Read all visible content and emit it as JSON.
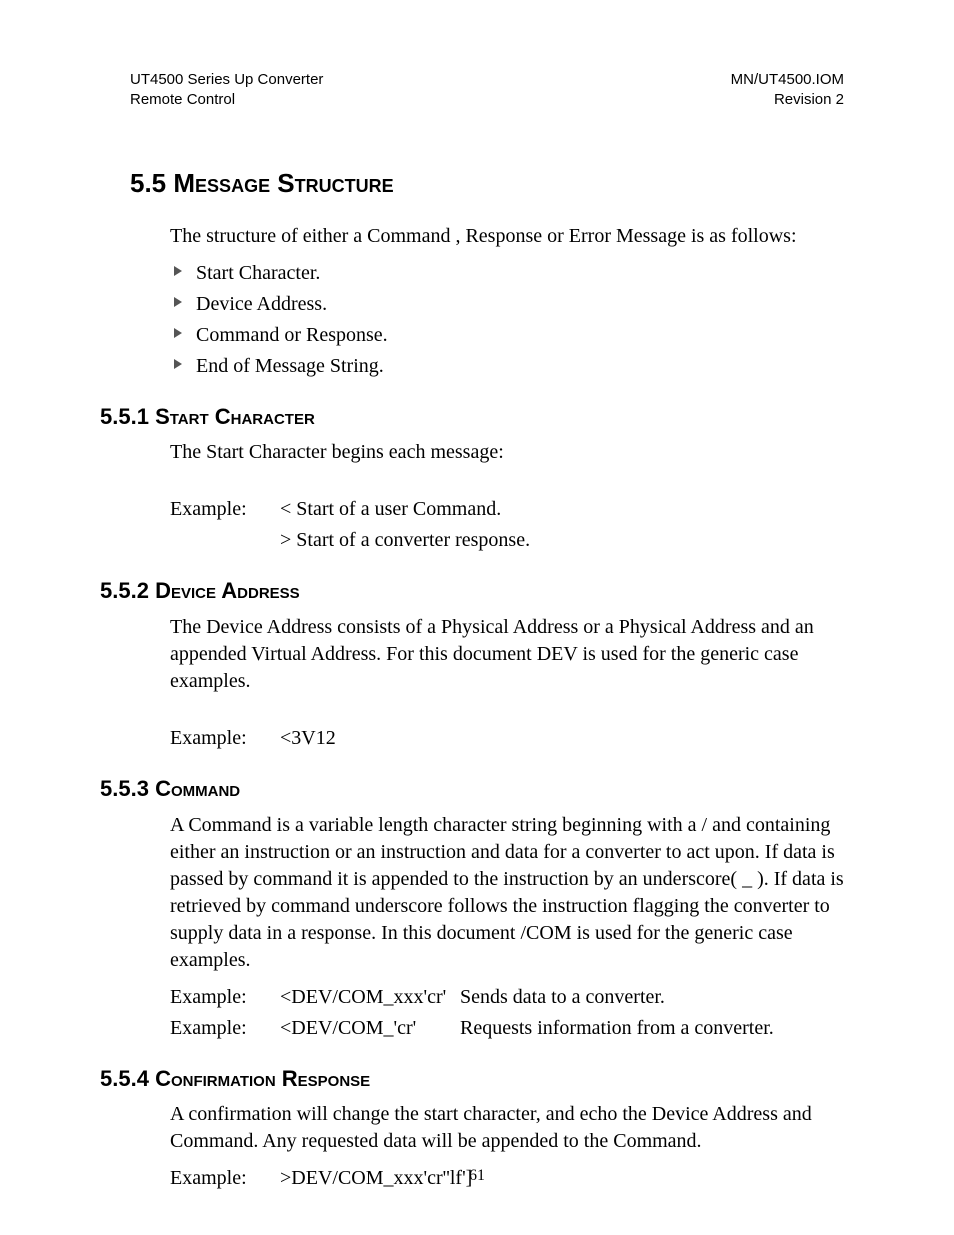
{
  "header": {
    "top_left_1": "UT4500 Series Up Converter",
    "top_left_2": "Remote Control",
    "top_right_1": "MN/UT4500.IOM",
    "top_right_2": "Revision 2"
  },
  "section_main": {
    "number": "5.5",
    "title": "Message Structure",
    "intro": "The structure of either a Command , Response or Error Message is as follows:",
    "bullets": [
      "Start Character.",
      "Device Address.",
      "Command or Response.",
      "End of Message String."
    ]
  },
  "sub1": {
    "number": "5.5.1",
    "title": "Start Character",
    "para": "The Start Character begins each message:",
    "example_label": "Example:",
    "line1": "< Start of a user Command.",
    "line2": "> Start of a converter response."
  },
  "sub2": {
    "number": "5.5.2",
    "title": "Device Address",
    "para": "The Device Address consists of a Physical Address or a Physical Address and an appended Virtual Address.  For this document DEV is used for the generic case examples.",
    "example_label": "Example:",
    "example_value": "<3V12"
  },
  "sub3": {
    "number": "5.5.3",
    "title": "Command",
    "para": "A Command is a variable length character string beginning with a / and containing either an instruction or an instruction and data for a converter to act upon.  If data is passed by command it is appended to the instruction by an underscore( _ ).  If data is retrieved by command underscore follows the instruction flagging the converter to supply data in a response.  In this document /COM is used for the generic case examples.",
    "ex1_label": "Example:",
    "ex1_code": "<DEV/COM_xxx'cr'",
    "ex1_desc": "Sends data to a converter.",
    "ex2_label": "Example:",
    "ex2_code": "<DEV/COM_'cr'",
    "ex2_desc": "Requests information from a converter."
  },
  "sub4": {
    "number": "5.5.4",
    "title": "Confirmation Response",
    "para": "A confirmation will change the start character, and echo the Device Address and Command.  Any requested data will be appended to the Command.",
    "example_label": "Example:",
    "example_value": ">DEV/COM_xxx'cr''lf']"
  },
  "page_number": "61"
}
